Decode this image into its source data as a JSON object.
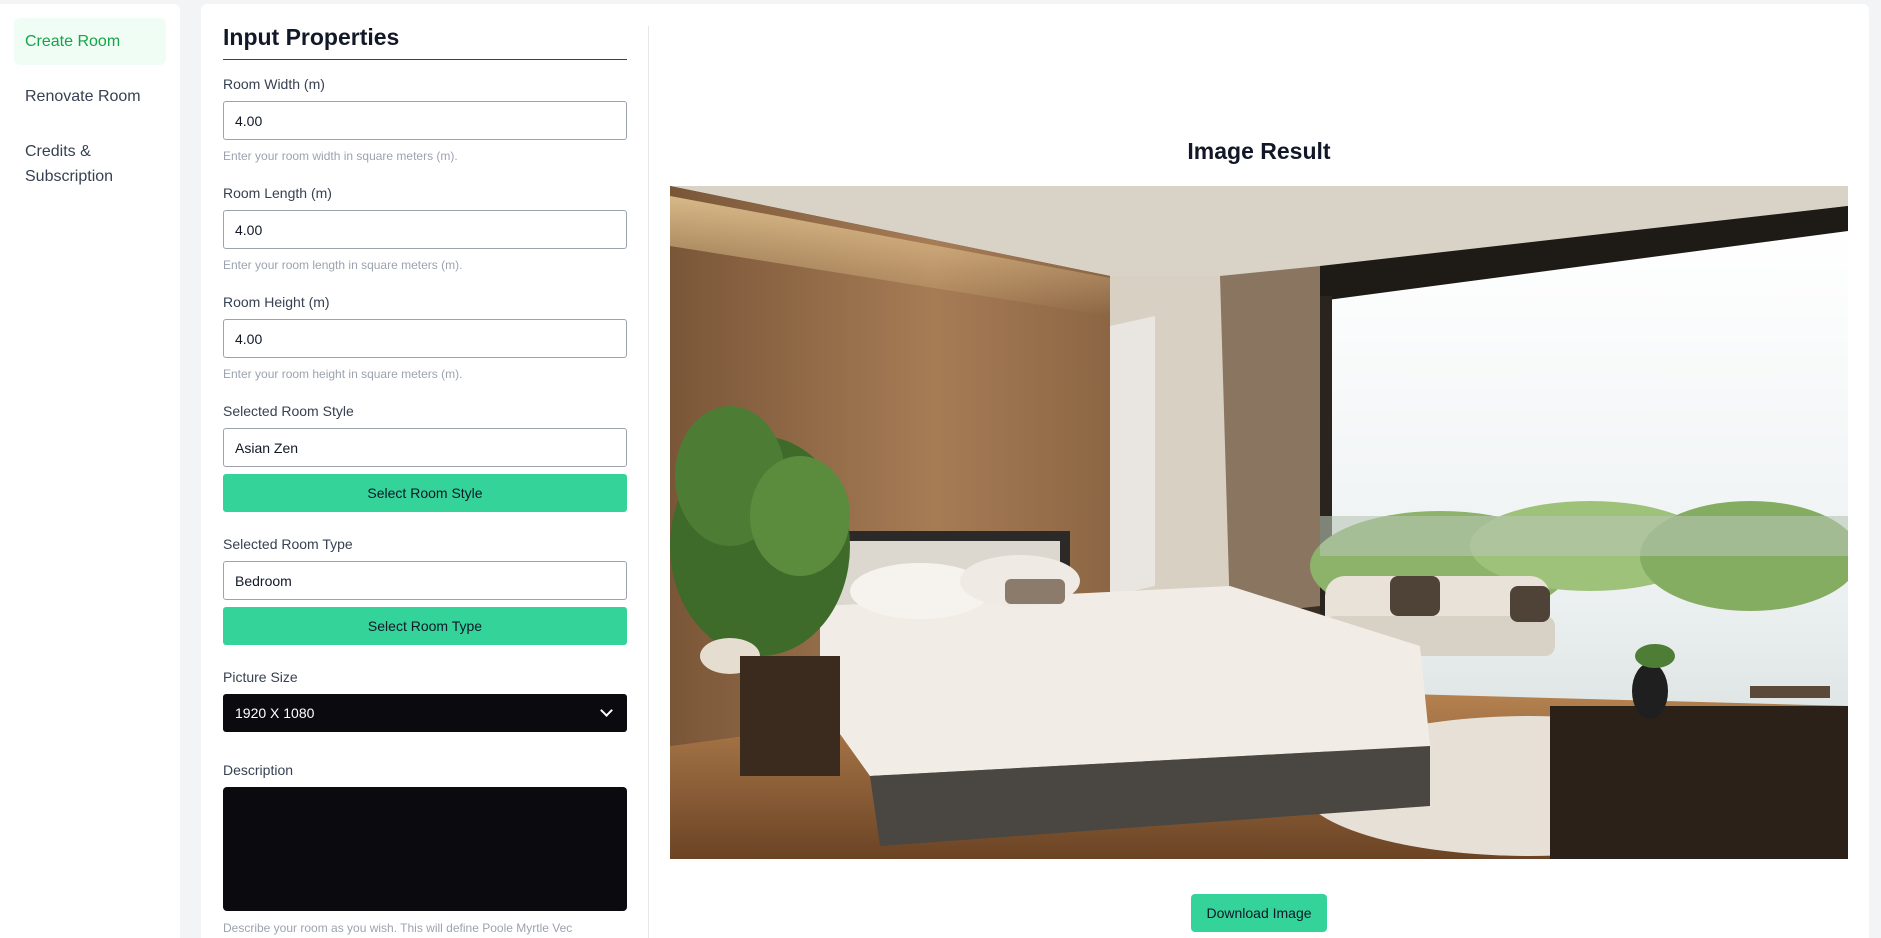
{
  "sidebar": {
    "items": [
      {
        "label": "Create Room"
      },
      {
        "label": "Renovate Room"
      },
      {
        "label": "Credits & Subscription"
      }
    ]
  },
  "form": {
    "title": "Input Properties",
    "width": {
      "label": "Room Width (m)",
      "value": "4.00",
      "hint": "Enter your room width in square meters (m)."
    },
    "length": {
      "label": "Room Length (m)",
      "value": "4.00",
      "hint": "Enter your room length in square meters (m)."
    },
    "height": {
      "label": "Room Height (m)",
      "value": "4.00",
      "hint": "Enter your room height in square meters (m)."
    },
    "style": {
      "label": "Selected Room Style",
      "value": "Asian Zen",
      "button": "Select Room Style"
    },
    "type": {
      "label": "Selected Room Type",
      "value": "Bedroom",
      "button": "Select Room Type"
    },
    "picture_size": {
      "label": "Picture Size",
      "value": "1920 X 1080"
    },
    "description": {
      "label": "Description",
      "value": "",
      "hint_partial": "Describe your room as you wish. This will define Poole Myrtle Vec"
    }
  },
  "result": {
    "title": "Image Result",
    "download_label": "Download Image"
  },
  "colors": {
    "accent": "#34d399",
    "active_nav_text": "#16a34a",
    "active_nav_bg": "#f0fdf4",
    "dark_input": "#0b0b0f"
  }
}
